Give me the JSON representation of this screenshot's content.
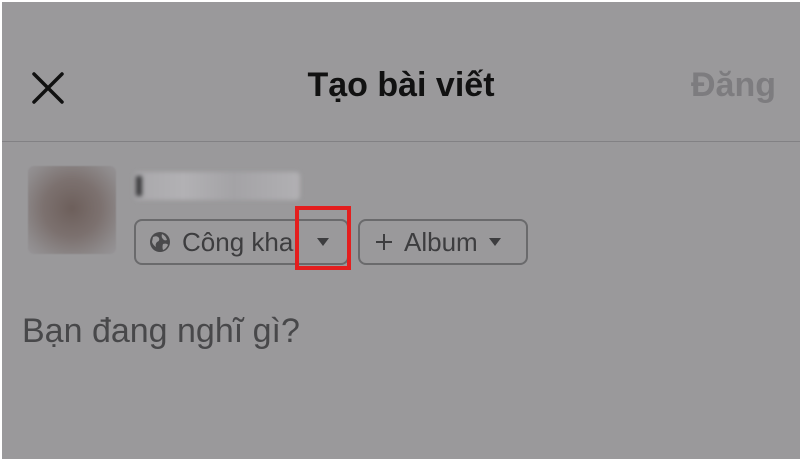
{
  "header": {
    "title": "Tạo bài viết",
    "post_label": "Đăng"
  },
  "icons": {
    "close": "close-icon",
    "privacy": "globe-icon",
    "privacy_caret": "chevron-down-icon",
    "album_add": "plus-icon",
    "album_caret": "chevron-down-icon"
  },
  "user": {
    "audience_label": "Công khai",
    "album_label": "Album"
  },
  "composer": {
    "placeholder": "Bạn đang nghĩ gì?"
  },
  "colors": {
    "overlay_background": "#9a999b",
    "highlight": "#e41e1e",
    "post_disabled": "#7d7c7f"
  }
}
